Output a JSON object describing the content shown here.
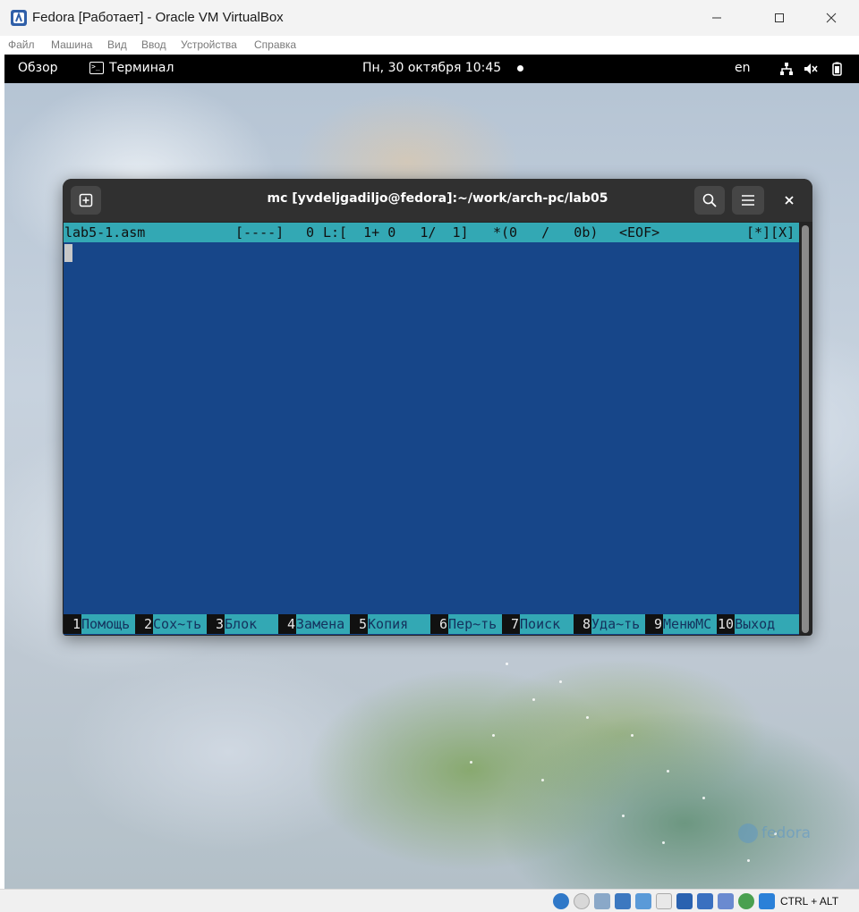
{
  "host_window": {
    "title": "Fedora [Работает] - Oracle VM VirtualBox",
    "menu": [
      "Файл",
      "Машина",
      "Вид",
      "Ввод",
      "Устройства",
      "Справка"
    ],
    "controls": [
      "minimize-icon",
      "maximize-icon",
      "close-icon"
    ]
  },
  "gnome_bar": {
    "overview": "Обзор",
    "app_name": "Терминал",
    "clock": "Пн, 30 октября  10:45",
    "lang": "en",
    "icons": [
      "network-icon",
      "volume-muted-icon",
      "battery-icon"
    ]
  },
  "terminal": {
    "title": "mc [yvdeljgadiljo@fedora]:~/work/arch-pc/lab05",
    "mc": {
      "status": {
        "filename": "lab5-1.asm",
        "flags": "[----]",
        "col": "0",
        "line_info": "L:[  1+ 0   1/  1]",
        "char_info": "*(0   /   0b)",
        "eof": "<EOF>",
        "buttons": "[*][X]"
      },
      "fkeys": [
        {
          "num": "1",
          "label": "Помощь"
        },
        {
          "num": "2",
          "label": "Сох~ть"
        },
        {
          "num": "3",
          "label": "Блок"
        },
        {
          "num": "4",
          "label": "Замена"
        },
        {
          "num": "5",
          "label": "Копия"
        },
        {
          "num": "6",
          "label": "Пер~ть"
        },
        {
          "num": "7",
          "label": "Поиск"
        },
        {
          "num": "8",
          "label": "Уда~ть"
        },
        {
          "num": "9",
          "label": "МенюMC"
        },
        {
          "num": "10",
          "label": "Выход"
        }
      ]
    }
  },
  "wallpaper": {
    "brand": "fedora"
  },
  "status_bar": {
    "host_key": "CTRL + ALT"
  },
  "colors": {
    "mc_background": "#174689",
    "mc_bar": "#33a8b4",
    "gnome_bar": "#000000"
  }
}
